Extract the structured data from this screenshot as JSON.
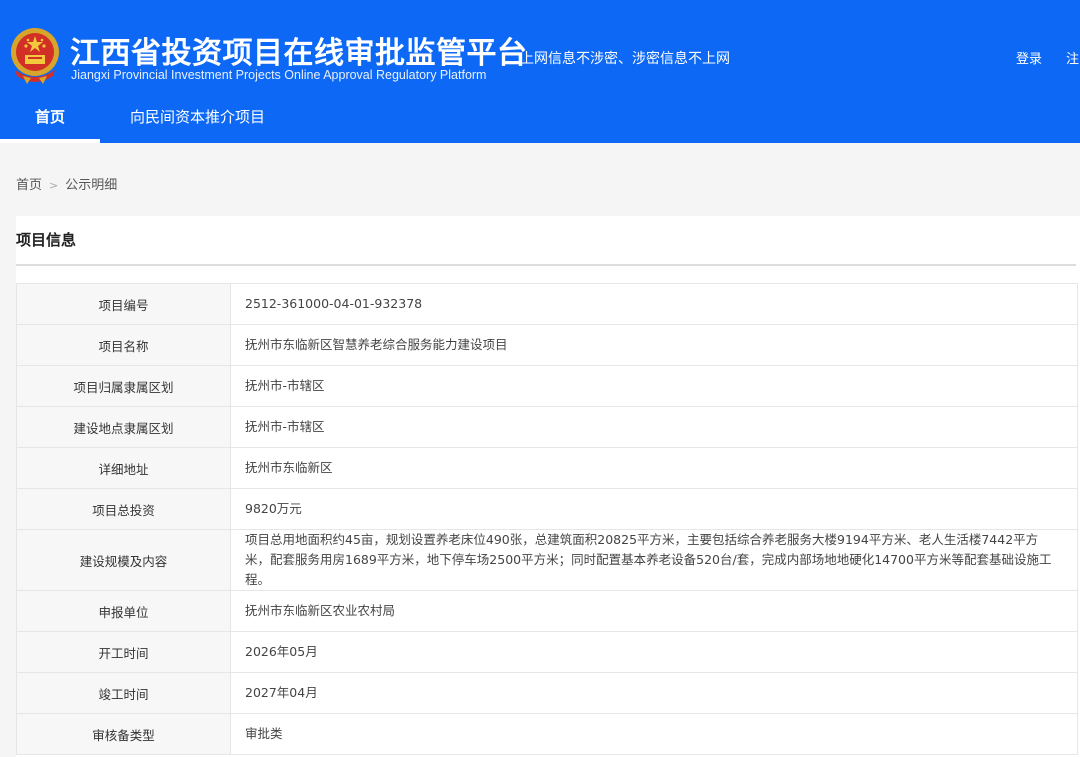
{
  "header": {
    "title": "江西省投资项目在线审批监管平台",
    "subtitle": "Jiangxi Provincial Investment Projects Online Approval Regulatory Platform",
    "slogan": "上网信息不涉密、涉密信息不上网",
    "login": "登录",
    "register": "注",
    "emblem_icon": "national-emblem-icon"
  },
  "nav": {
    "home": "首页",
    "promo": "向民间资本推介项目"
  },
  "breadcrumb": {
    "home": "首页",
    "current": "公示明细"
  },
  "panel": {
    "title": "项目信息"
  },
  "table": {
    "rows": [
      {
        "label": "项目编号",
        "value": "2512-361000-04-01-932378"
      },
      {
        "label": "项目名称",
        "value": "抚州市东临新区智慧养老综合服务能力建设项目"
      },
      {
        "label": "项目归属隶属区划",
        "value": "抚州市-市辖区"
      },
      {
        "label": "建设地点隶属区划",
        "value": "抚州市-市辖区"
      },
      {
        "label": "详细地址",
        "value": "抚州市东临新区"
      },
      {
        "label": "项目总投资",
        "value": "9820万元"
      },
      {
        "label": "建设规模及内容",
        "value": "项目总用地面积约45亩，规划设置养老床位490张，总建筑面积20825平方米，主要包括综合养老服务大楼9194平方米、老人生活楼7442平方米，配套服务用房1689平方米，地下停车场2500平方米；同时配置基本养老设备520台/套，完成内部场地地硬化14700平方米等配套基础设施工程。"
      },
      {
        "label": "申报单位",
        "value": "抚州市东临新区农业农村局"
      },
      {
        "label": "开工时间",
        "value": "2026年05月"
      },
      {
        "label": "竣工时间",
        "value": "2027年04月"
      },
      {
        "label": "审核备类型",
        "value": "审批类"
      }
    ]
  },
  "colors": {
    "header_bg": "#0c68f5",
    "page_bg": "#f5f5f5",
    "label_bg": "#f7f7f7"
  }
}
